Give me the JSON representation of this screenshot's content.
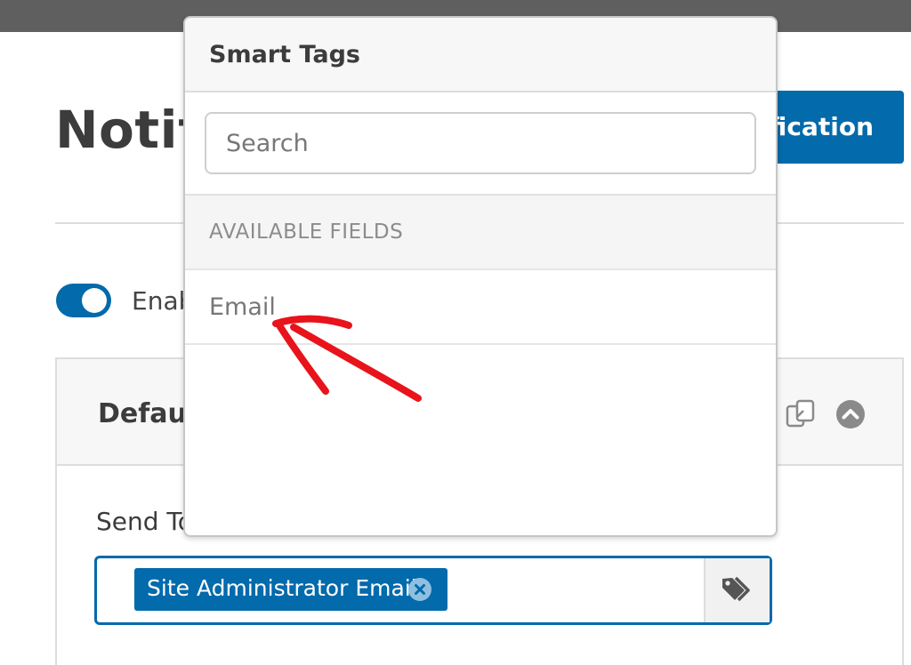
{
  "page": {
    "title": "Notif",
    "add_button_label": "ification",
    "enable_toggle_label": "Enab",
    "enable_toggle_on": true
  },
  "panel": {
    "title": "Defau",
    "send_to_label": "Send To",
    "recipient_chip": "Site Administrator Email"
  },
  "smart_tags": {
    "title": "Smart Tags",
    "search_placeholder": "Search",
    "section_heading": "AVAILABLE FIELDS",
    "fields": [
      "Email"
    ]
  },
  "icons": {
    "clone": "clone-icon",
    "collapse": "chevron-up-circle-icon",
    "chip_remove": "remove-circle-icon",
    "smart_tags": "tags-icon"
  },
  "colors": {
    "accent": "#036aab",
    "annotation": "#e8131b",
    "topbar": "#5f5f5f"
  }
}
